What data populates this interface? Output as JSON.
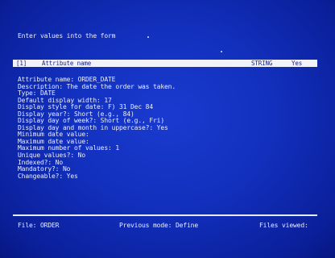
{
  "prompt": "Enter values into the form",
  "header_bar": {
    "code": "[1]",
    "label": "Attribute name",
    "type": "STRING",
    "flag": "Yes"
  },
  "form_lines": [
    "Attribute name: ORDER_DATE",
    "Description: The date the order was taken.",
    "Type: DATE",
    "Default display width: 17",
    "Display style for date: F) 31 Dec 84",
    "Display year?: Short (e.g., 84)",
    "Display day of week?: Short (e.g., Fri)",
    "Display day and month in uppercase?: Yes",
    "Minimum date value:",
    "Maximum date value:",
    "Maximum number of values: 1",
    "Unique values?: No",
    "Indexed?: No",
    "Mandatory?: No",
    "Changeable?: Yes"
  ],
  "status_bar": {
    "file": "File: ORDER",
    "previous_mode": "Previous mode: Define",
    "files_viewed": "Files viewed:"
  }
}
